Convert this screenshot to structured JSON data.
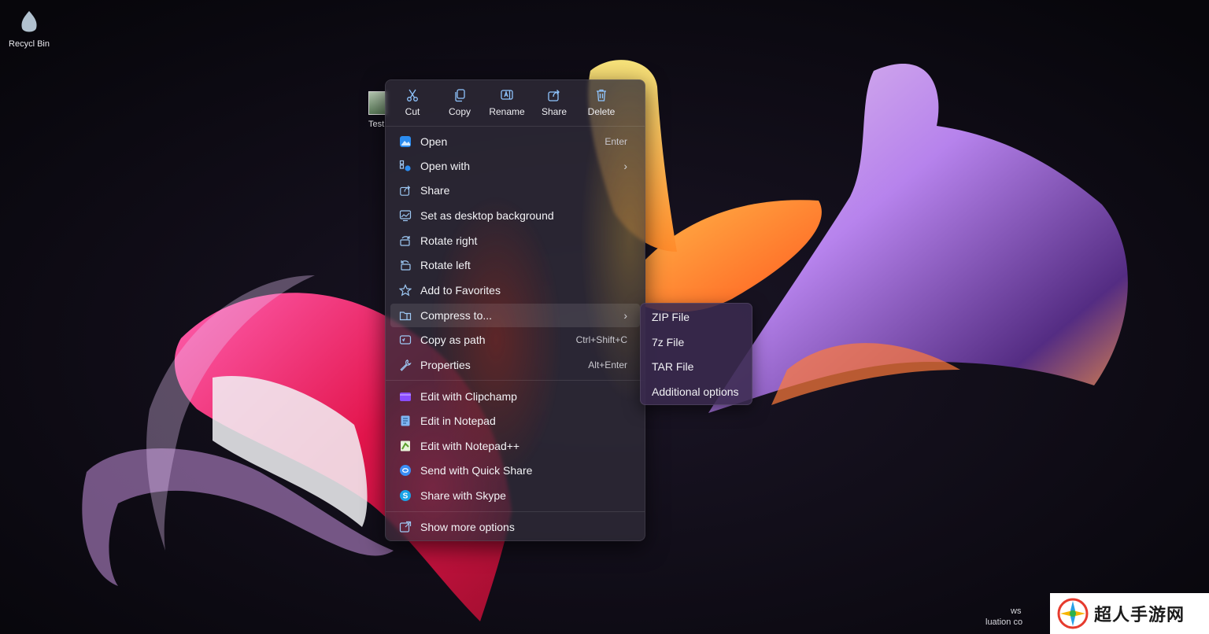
{
  "desktop": {
    "icons": [
      {
        "label": "Recycl  Bin"
      },
      {
        "label": "Test"
      }
    ],
    "evaluation_text": [
      "ws",
      "luation co"
    ]
  },
  "toolbar": [
    {
      "label": "Cut",
      "icon": "scissors-icon"
    },
    {
      "label": "Copy",
      "icon": "copy-icon"
    },
    {
      "label": "Rename",
      "icon": "rename-icon"
    },
    {
      "label": "Share",
      "icon": "share-icon"
    },
    {
      "label": "Delete",
      "icon": "trash-icon"
    }
  ],
  "menu": {
    "items": [
      {
        "label": "Open",
        "shortcut": "Enter",
        "icon": "photos-app-icon"
      },
      {
        "label": "Open with",
        "icon": "open-with-icon",
        "submenu": true
      },
      {
        "label": "Share",
        "icon": "share-icon"
      },
      {
        "label": "Set as desktop background",
        "icon": "desktop-background-icon"
      },
      {
        "label": "Rotate right",
        "icon": "rotate-right-icon"
      },
      {
        "label": "Rotate left",
        "icon": "rotate-left-icon"
      },
      {
        "label": "Add to Favorites",
        "icon": "star-icon"
      },
      {
        "label": "Compress to...",
        "icon": "compress-icon",
        "submenu": true,
        "highlighted": true
      },
      {
        "label": "Copy as path",
        "shortcut": "Ctrl+Shift+C",
        "icon": "copy-path-icon"
      },
      {
        "label": "Properties",
        "shortcut": "Alt+Enter",
        "icon": "wrench-icon"
      },
      {
        "label": "Edit with Clipchamp",
        "icon": "clipchamp-icon"
      },
      {
        "label": "Edit in Notepad",
        "icon": "notepad-icon"
      },
      {
        "label": "Edit with Notepad++",
        "icon": "notepad-plus-plus-icon"
      },
      {
        "label": "Send with Quick Share",
        "icon": "quick-share-icon"
      },
      {
        "label": "Share with Skype",
        "icon": "skype-icon"
      },
      {
        "label": "Show more options",
        "icon": "show-more-options-icon"
      }
    ]
  },
  "submenu": {
    "items": [
      {
        "label": "ZIP File"
      },
      {
        "label": "7z File"
      },
      {
        "label": "TAR File"
      },
      {
        "label": "Additional options"
      }
    ]
  },
  "watermark": {
    "text": "超人手游网"
  },
  "colors": {
    "accent": "#4aa3ff",
    "menu_bg": "#302c38",
    "submenu_bg": "#3a2a4e"
  }
}
